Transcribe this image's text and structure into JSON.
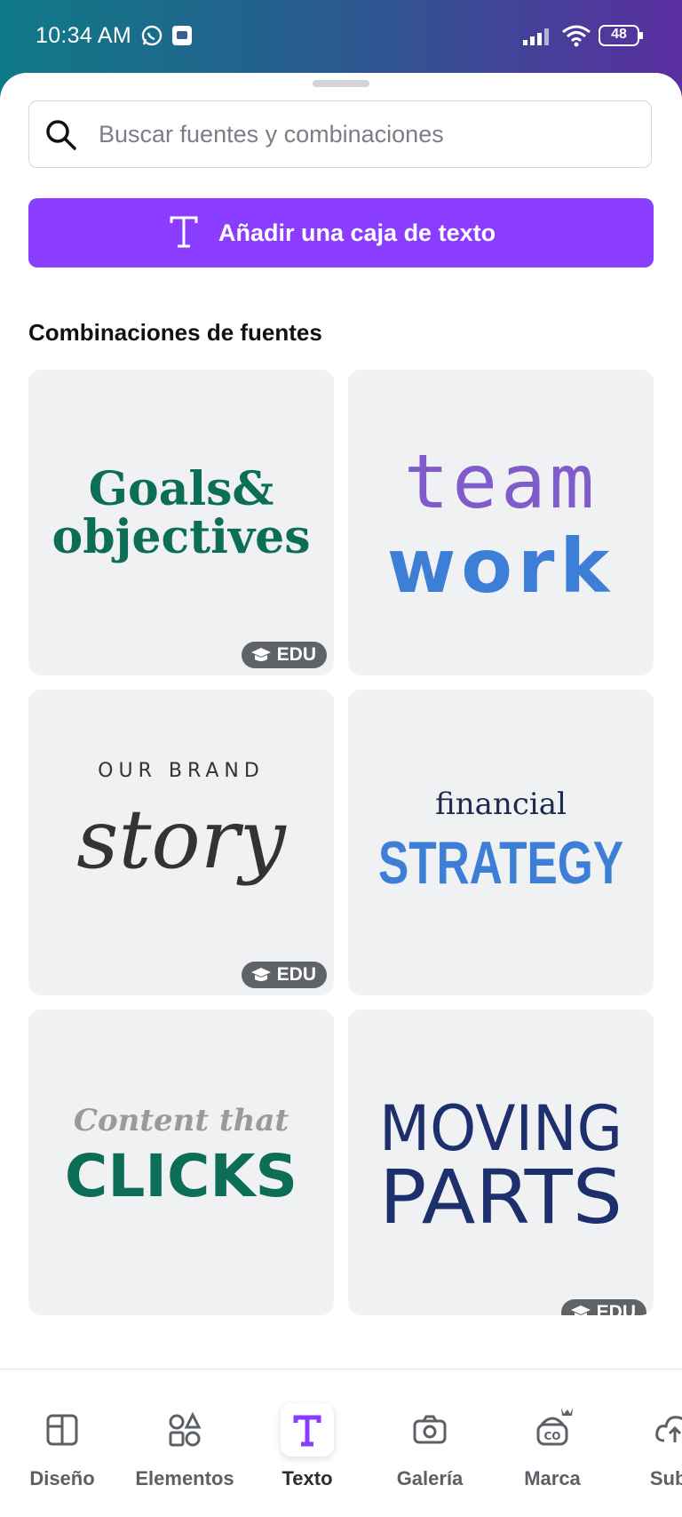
{
  "status_bar": {
    "time": "10:34 AM",
    "battery": "48",
    "icons": [
      "whatsapp-icon",
      "app-notification-icon",
      "signal-icon",
      "wifi-icon",
      "battery-icon"
    ]
  },
  "search": {
    "placeholder": "Buscar fuentes y combinaciones",
    "icon": "search-icon"
  },
  "add_text_button": {
    "label": "Añadir una caja de texto",
    "icon": "text-icon"
  },
  "section": {
    "title": "Combinaciones de fuentes"
  },
  "font_combos": [
    {
      "line1": "Goals&",
      "line2": "objectives",
      "badge": "EDU"
    },
    {
      "line1": "team",
      "line2": "work",
      "badge": ""
    },
    {
      "line1": "OUR BRAND",
      "line2": "story",
      "badge": "EDU"
    },
    {
      "line1": "financial",
      "line2": "STRATEGY",
      "badge": ""
    },
    {
      "line1": "Content that",
      "line2": "CLICKS",
      "badge": ""
    },
    {
      "line1": "MOVING",
      "line2": "PARTS",
      "badge": "EDU"
    }
  ],
  "bottom_nav": [
    {
      "label": "Diseño",
      "icon": "design-layout-icon",
      "active": false
    },
    {
      "label": "Elementos",
      "icon": "elements-shapes-icon",
      "active": false
    },
    {
      "label": "Texto",
      "icon": "text-icon",
      "active": true
    },
    {
      "label": "Galería",
      "icon": "camera-icon",
      "active": false
    },
    {
      "label": "Marca",
      "icon": "brand-kit-icon",
      "active": false
    },
    {
      "label": "Subir",
      "icon": "upload-cloud-icon",
      "active": false
    }
  ],
  "colors": {
    "accent": "#8b3dff",
    "edu_badge": "#5f6368",
    "card_bg": "#f0f1f3"
  }
}
